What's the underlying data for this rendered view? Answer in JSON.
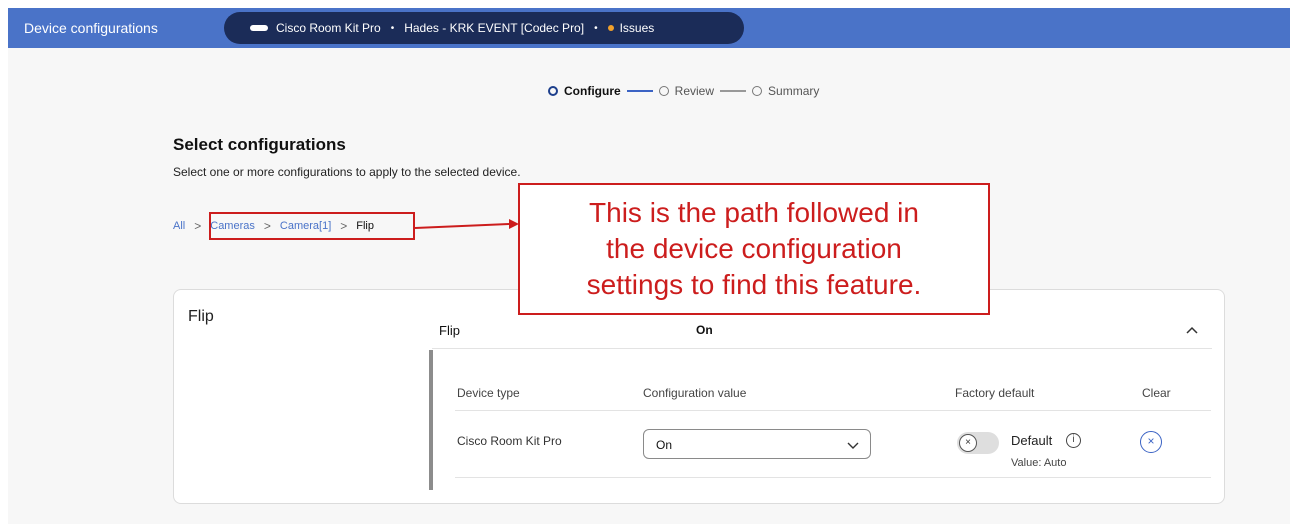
{
  "topbar": {
    "title": "Device configurations",
    "device_name": "Cisco Room Kit Pro",
    "workspace": "Hades - KRK EVENT [Codec Pro]",
    "issues_label": "Issues",
    "separator": "•"
  },
  "stepper": {
    "steps": [
      {
        "label": "Configure",
        "active": true
      },
      {
        "label": "Review",
        "active": false
      },
      {
        "label": "Summary",
        "active": false
      }
    ]
  },
  "page": {
    "title": "Select configurations",
    "subtitle": "Select one or more configurations to apply to the selected device."
  },
  "breadcrumb": {
    "items": [
      "All",
      "Cameras",
      "Camera[1]",
      "Flip"
    ],
    "separator": ">"
  },
  "annotation": {
    "lines": [
      "This is the path followed in",
      "the device configuration",
      "settings to find this feature."
    ]
  },
  "card": {
    "title": "Flip",
    "row_name": "Flip",
    "row_value": "On",
    "columns": [
      "Device type",
      "Configuration value",
      "Factory default",
      "Clear"
    ],
    "device_type": "Cisco Room Kit Pro",
    "config_value": "On",
    "default_label": "Default",
    "default_value": "Value: Auto",
    "info_glyph": "i",
    "toggle_glyph": "×",
    "clear_glyph": "×"
  },
  "colors": {
    "topbar": "#4a73c8",
    "pill": "#1b2c58",
    "issue_dot": "#f0a02b",
    "annotation": "#cc1d1d",
    "link": "#4a73c8"
  }
}
